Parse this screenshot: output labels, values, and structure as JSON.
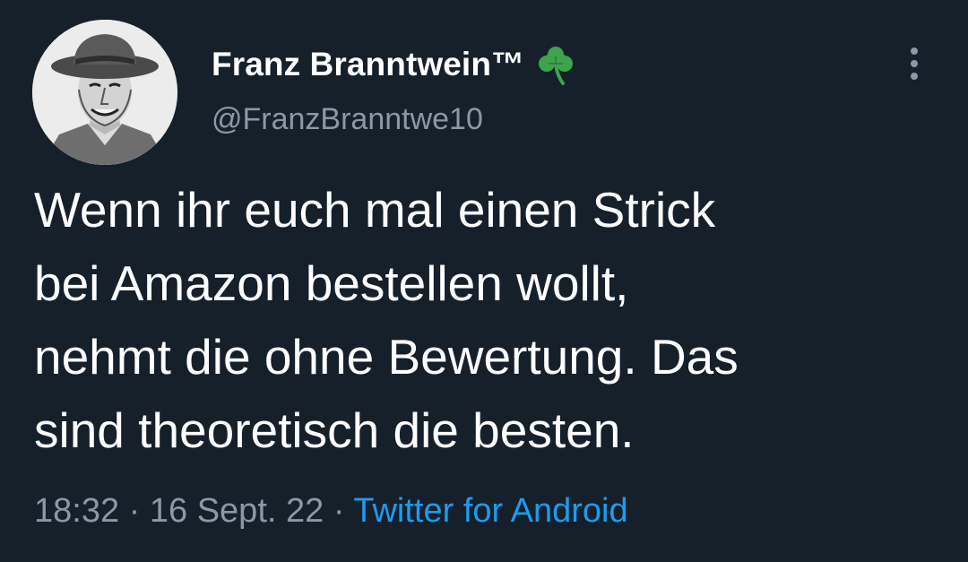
{
  "tweet": {
    "author": {
      "display_name": "Franz Branntwein™",
      "handle": "@FranzBranntwe10",
      "badge_icon": "shamrock-icon",
      "avatar_icon": "avatar-photo"
    },
    "text_lines": [
      "Wenn ihr euch mal einen Strick",
      "bei Amazon bestellen wollt,",
      "nehmt die ohne Bewertung. Das",
      "sind theoretisch die besten."
    ],
    "time": "18:32",
    "separator": "·",
    "date": "16 Sept. 22",
    "source": "Twitter for Android",
    "more_icon": "more-vertical-icon"
  },
  "colors": {
    "background": "#15202b",
    "text_primary": "#ffffff",
    "text_secondary": "#8b98a5",
    "link": "#1d9bf0",
    "badge_green": "#3fa34d"
  }
}
